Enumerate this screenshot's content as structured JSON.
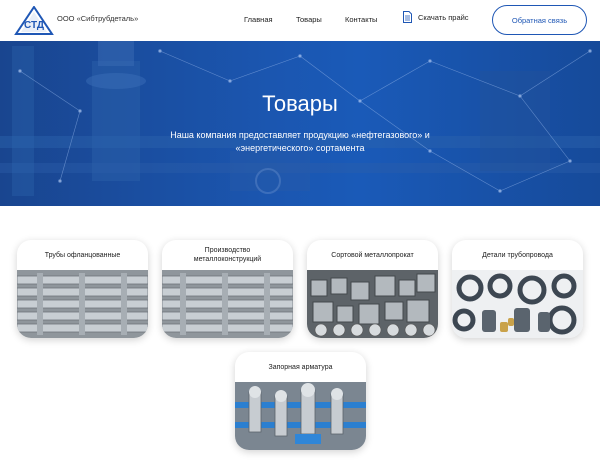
{
  "header": {
    "logo_text": "СТД",
    "company": "ООО «Сибтрубдеталь»",
    "nav": [
      "Главная",
      "Товары",
      "Контакты"
    ],
    "price_link": "Скачать прайс",
    "feedback_button": "Обратная связь"
  },
  "hero": {
    "title": "Товары",
    "subtitle": "Наша компания предоставляет продукцию «нефтегазового» и «энергетического» сортамента"
  },
  "products": [
    {
      "label": "Трубы офланцованные",
      "image": "flanged-pipes-photo"
    },
    {
      "label": "Производство металлоконструкций",
      "image": "metal-structures-photo"
    },
    {
      "label": "Сортовой металлопрокат",
      "image": "rolled-metal-photo"
    },
    {
      "label": "Детали трубопровода",
      "image": "pipeline-parts-photo"
    },
    {
      "label": "Запорная арматура",
      "image": "valves-photo"
    }
  ],
  "colors": {
    "accent": "#1f57b5",
    "hero": "#1b56b0"
  }
}
